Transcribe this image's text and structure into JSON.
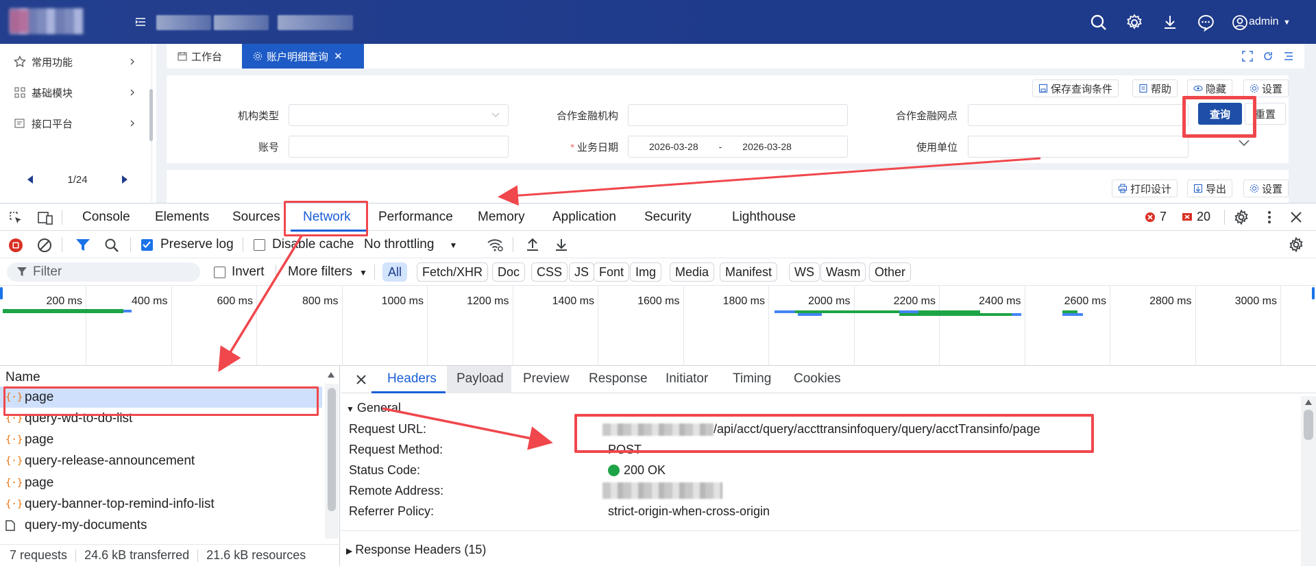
{
  "app": {
    "user": "admin"
  },
  "sidebar": {
    "items": [
      {
        "label": "常用功能"
      },
      {
        "label": "基础模块"
      },
      {
        "label": "接口平台"
      }
    ],
    "pager": "1/24"
  },
  "tabs": {
    "workbench": "工作台",
    "account": "账户明细查询"
  },
  "toolbar": {
    "save_conditions": "保存查询条件",
    "help": "帮助",
    "hide": "隐藏",
    "settings": "设置",
    "print_design": "打印设计",
    "export": "导出",
    "settings2": "设置"
  },
  "form": {
    "org_type_label": "机构类型",
    "partner_org_label": "合作金融机构",
    "partner_branch_label": "合作金融网点",
    "account_label": "账号",
    "biz_date_label": "业务日期",
    "date_from": "2026-03-28",
    "date_sep": "-",
    "date_to": "2026-03-28",
    "use_unit_label": "使用单位",
    "query_btn": "查询",
    "reset_btn": "重置"
  },
  "devtools": {
    "tabs": [
      "Console",
      "Elements",
      "Sources",
      "Network",
      "Performance",
      "Memory",
      "Application",
      "Security",
      "Lighthouse"
    ],
    "errors": "7",
    "issues": "20",
    "preserve_log": "Preserve log",
    "disable_cache": "Disable cache",
    "throttling": "No throttling",
    "filter_placeholder": "Filter",
    "invert": "Invert",
    "more_filters": "More filters",
    "chips": [
      "All",
      "Fetch/XHR",
      "Doc",
      "CSS",
      "JS",
      "Font",
      "Img",
      "Media",
      "Manifest",
      "WS",
      "Wasm",
      "Other"
    ],
    "timeline_ticks": [
      "200 ms",
      "400 ms",
      "600 ms",
      "800 ms",
      "1000 ms",
      "1200 ms",
      "1400 ms",
      "1600 ms",
      "1800 ms",
      "2000 ms",
      "2200 ms",
      "2400 ms",
      "2600 ms",
      "2800 ms",
      "3000 ms"
    ],
    "name_header": "Name",
    "requests": [
      {
        "name": "page",
        "type": "xhr"
      },
      {
        "name": "query-wd-to-do-list",
        "type": "xhr"
      },
      {
        "name": "page",
        "type": "xhr"
      },
      {
        "name": "query-release-announcement",
        "type": "xhr"
      },
      {
        "name": "page",
        "type": "xhr"
      },
      {
        "name": "query-banner-top-remind-info-list",
        "type": "xhr"
      },
      {
        "name": "query-my-documents",
        "type": "doc"
      }
    ],
    "footer": {
      "requests": "7 requests",
      "transferred": "24.6 kB transferred",
      "resources": "21.6 kB resources"
    },
    "detail_tabs": [
      "Headers",
      "Payload",
      "Preview",
      "Response",
      "Initiator",
      "Timing",
      "Cookies"
    ],
    "general_title": "General",
    "general": {
      "request_url_key": "Request URL:",
      "request_url_val": "/api/acct/query/accttransinfoquery/query/acctTransinfo/page",
      "method_key": "Request Method:",
      "method_val": "POST",
      "status_key": "Status Code:",
      "status_val": "200 OK",
      "remote_key": "Remote Address:",
      "referrer_key": "Referrer Policy:",
      "referrer_val": "strict-origin-when-cross-origin"
    },
    "response_headers": "Response Headers (15)"
  },
  "colors": {
    "header_bg": "#1e3a8a",
    "accent": "#1e5bc6",
    "devtools_blue": "#1a5fd6",
    "annotation_red": "#f0474c",
    "status_green": "#1ea446"
  }
}
